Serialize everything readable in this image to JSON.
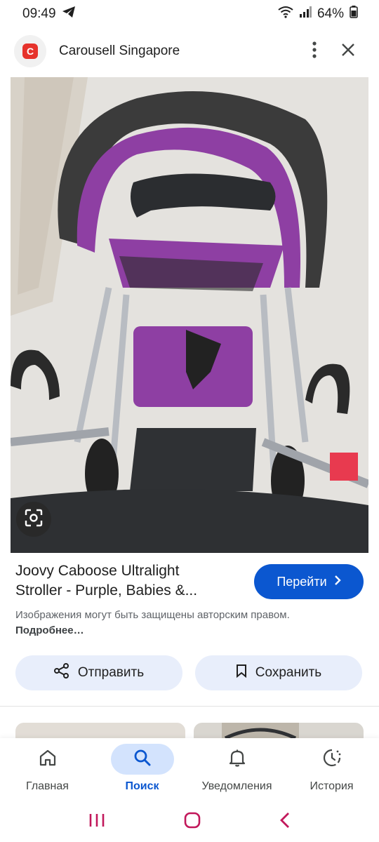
{
  "status": {
    "time": "09:49",
    "battery": "64%"
  },
  "app_bar": {
    "site_name": "Carousell Singapore",
    "logo_letter": "C"
  },
  "result": {
    "title_line1": "Joovy Caboose Ultralight",
    "title_line2": "Stroller - Purple, Babies &...",
    "go_label": "Перейти",
    "copyright_text": "Изображения могут быть защищены авторским правом.",
    "more_link": "Подробнее…"
  },
  "actions": {
    "share_label": "Отправить",
    "save_label": "Сохранить"
  },
  "bottom_nav": {
    "items": [
      {
        "label": "Главная",
        "icon": "home-icon"
      },
      {
        "label": "Поиск",
        "icon": "search-icon",
        "active": true
      },
      {
        "label": "Уведомления",
        "icon": "bell-icon"
      },
      {
        "label": "История",
        "icon": "history-icon"
      }
    ]
  },
  "colors": {
    "accent": "#0b57d0",
    "accent_soft": "#d3e3fd",
    "chip_bg": "#e8eefb",
    "brand_red": "#e6322b",
    "stroller_purple": "#8e3fa3"
  }
}
